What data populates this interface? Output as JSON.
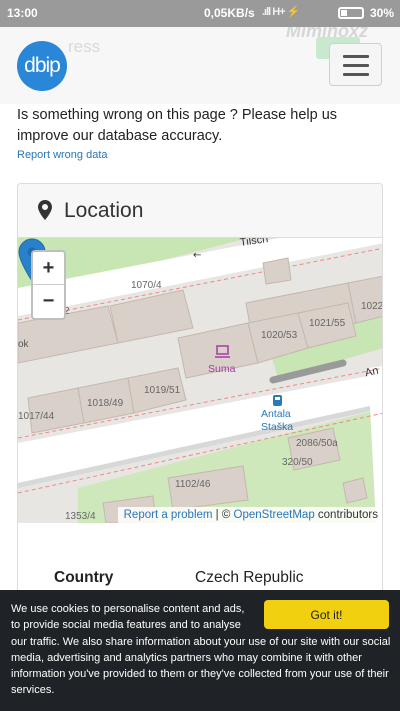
{
  "status_bar": {
    "time": "13:00",
    "speed": "0,05KB/s",
    "signal": "H+",
    "battery": "30%"
  },
  "header": {
    "logo_text": "dbip",
    "ghost_text": "ress",
    "watermark": "Miminoxz",
    "menu_icon": "hamburger-icon"
  },
  "help": {
    "text": "Is something wrong on this page ? Please help us improve our database accuracy.",
    "report_link": "Report wrong data"
  },
  "location_card": {
    "title": "Location",
    "icon": "map-marker-icon",
    "map": {
      "zoom_in": "+",
      "zoom_out": "−",
      "street_top": "Tilsch",
      "street_right": "An",
      "street_left": "ok",
      "house_numbers": [
        "1070/4",
        "1022",
        "1020/53",
        "1021/55",
        "1019/51",
        "1018/49",
        "1017/44",
        "2086/50a",
        "320/50",
        "1102/46",
        "1353/4",
        "2"
      ],
      "poi_shop": "Suma",
      "poi_stop_line1": "Antala",
      "poi_stop_line2": "Staška",
      "attribution_link1": "Report a problem",
      "attribution_sep": " | © ",
      "attribution_link2": "OpenStreetMap",
      "attribution_suffix": " contributors",
      "colors": {
        "building": "#d9d0c9",
        "road": "#ffffff",
        "green": "#c8e6b4",
        "marker": "#2a81cb"
      }
    },
    "fields": [
      {
        "label": "Country",
        "value": "Czech Republic"
      }
    ]
  },
  "cookie": {
    "text_line1": "We use cookies to personalise content and ads, to provide social media features and to analyse",
    "text_rest": "our traffic. We also share information about your use of our site with our social media, advertising and analytics partners who may combine it with other information you've provided to them or they've collected from your use of their services.",
    "button": "Got it!",
    "button_color": "#f1d00f"
  }
}
